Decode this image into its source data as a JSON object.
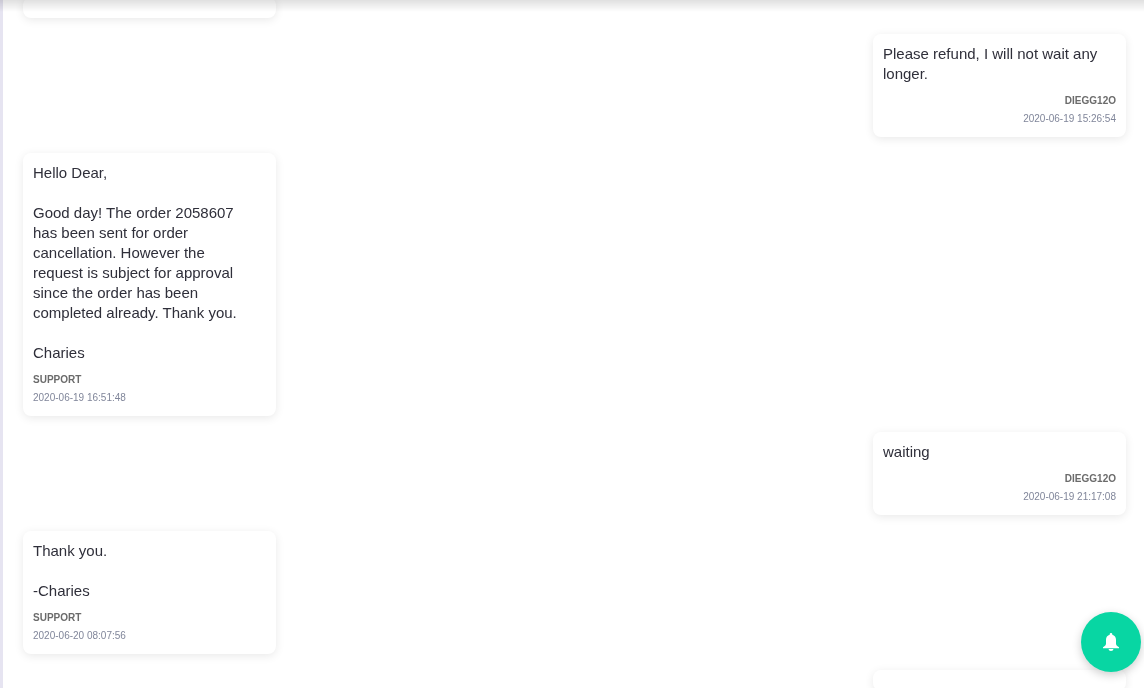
{
  "messages": [
    {
      "kind": "support"
    },
    {
      "kind": "customer",
      "text": "Please refund, I will not wait any longer.",
      "sender": "DIEGG12O",
      "timestamp": "2020-06-19 15:26:54"
    },
    {
      "kind": "support",
      "text": "Hello Dear,\n\nGood day! The order 2058607 has been sent for order cancellation. However the request is subject for approval since the order has been completed already. Thank you.\n\nCharies",
      "sender": "SUPPORT",
      "timestamp": "2020-06-19 16:51:48"
    },
    {
      "kind": "customer",
      "text": "waiting",
      "sender": "DIEGG12O",
      "timestamp": "2020-06-19 21:17:08"
    },
    {
      "kind": "support",
      "text": "Thank you.\n\n-Charies",
      "sender": "SUPPORT",
      "timestamp": "2020-06-20 08:07:56"
    },
    {
      "kind": "customer"
    }
  ]
}
